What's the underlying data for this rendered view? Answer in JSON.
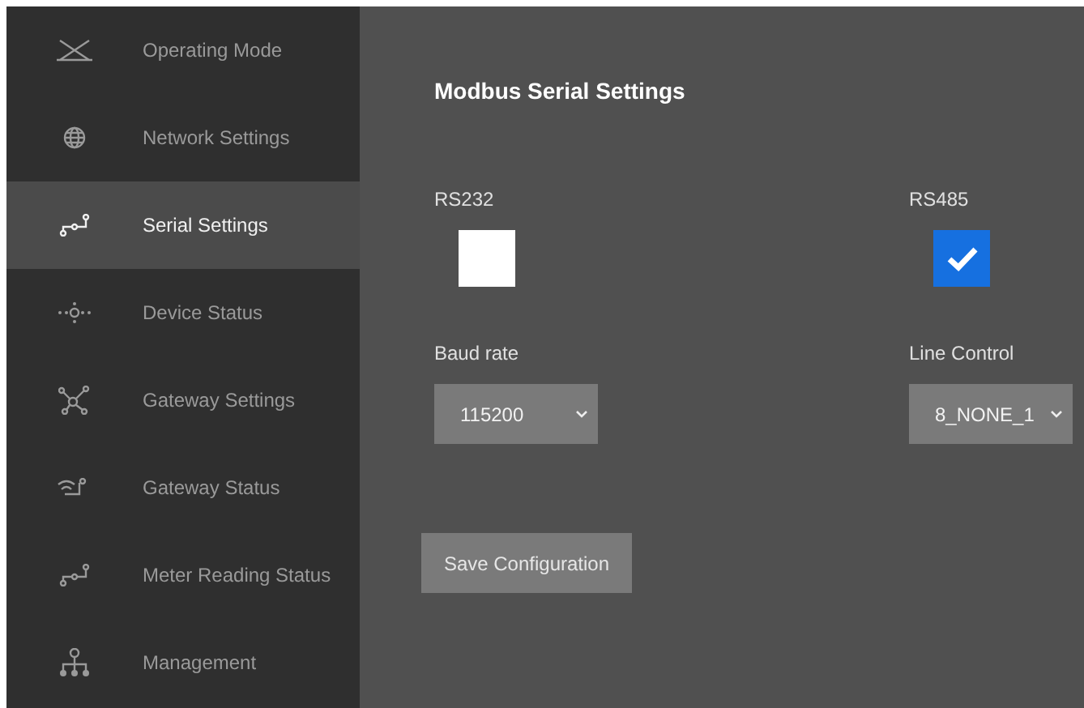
{
  "sidebar": {
    "items": [
      {
        "label": "Operating Mode",
        "kind": "cross",
        "selected": false
      },
      {
        "label": "Network Settings",
        "kind": "globe",
        "selected": false
      },
      {
        "label": "Serial Settings",
        "kind": "serial",
        "selected": true
      },
      {
        "label": "Device Status",
        "kind": "dots",
        "selected": false
      },
      {
        "label": "Gateway Settings",
        "kind": "hub",
        "selected": false
      },
      {
        "label": "Gateway Status",
        "kind": "wireless",
        "selected": false
      },
      {
        "label": "Meter Reading Status",
        "kind": "serial",
        "selected": false
      },
      {
        "label": "Management",
        "kind": "tree",
        "selected": false
      }
    ]
  },
  "main": {
    "title": "Modbus Serial Settings",
    "checkboxes": [
      {
        "label": "RS232",
        "checked": false
      },
      {
        "label": "RS485",
        "checked": true
      }
    ],
    "selects": [
      {
        "label": "Baud rate",
        "value": "115200"
      },
      {
        "label": "Line Control",
        "value": "8_NONE_1"
      }
    ],
    "save_button": "Save Configuration"
  }
}
